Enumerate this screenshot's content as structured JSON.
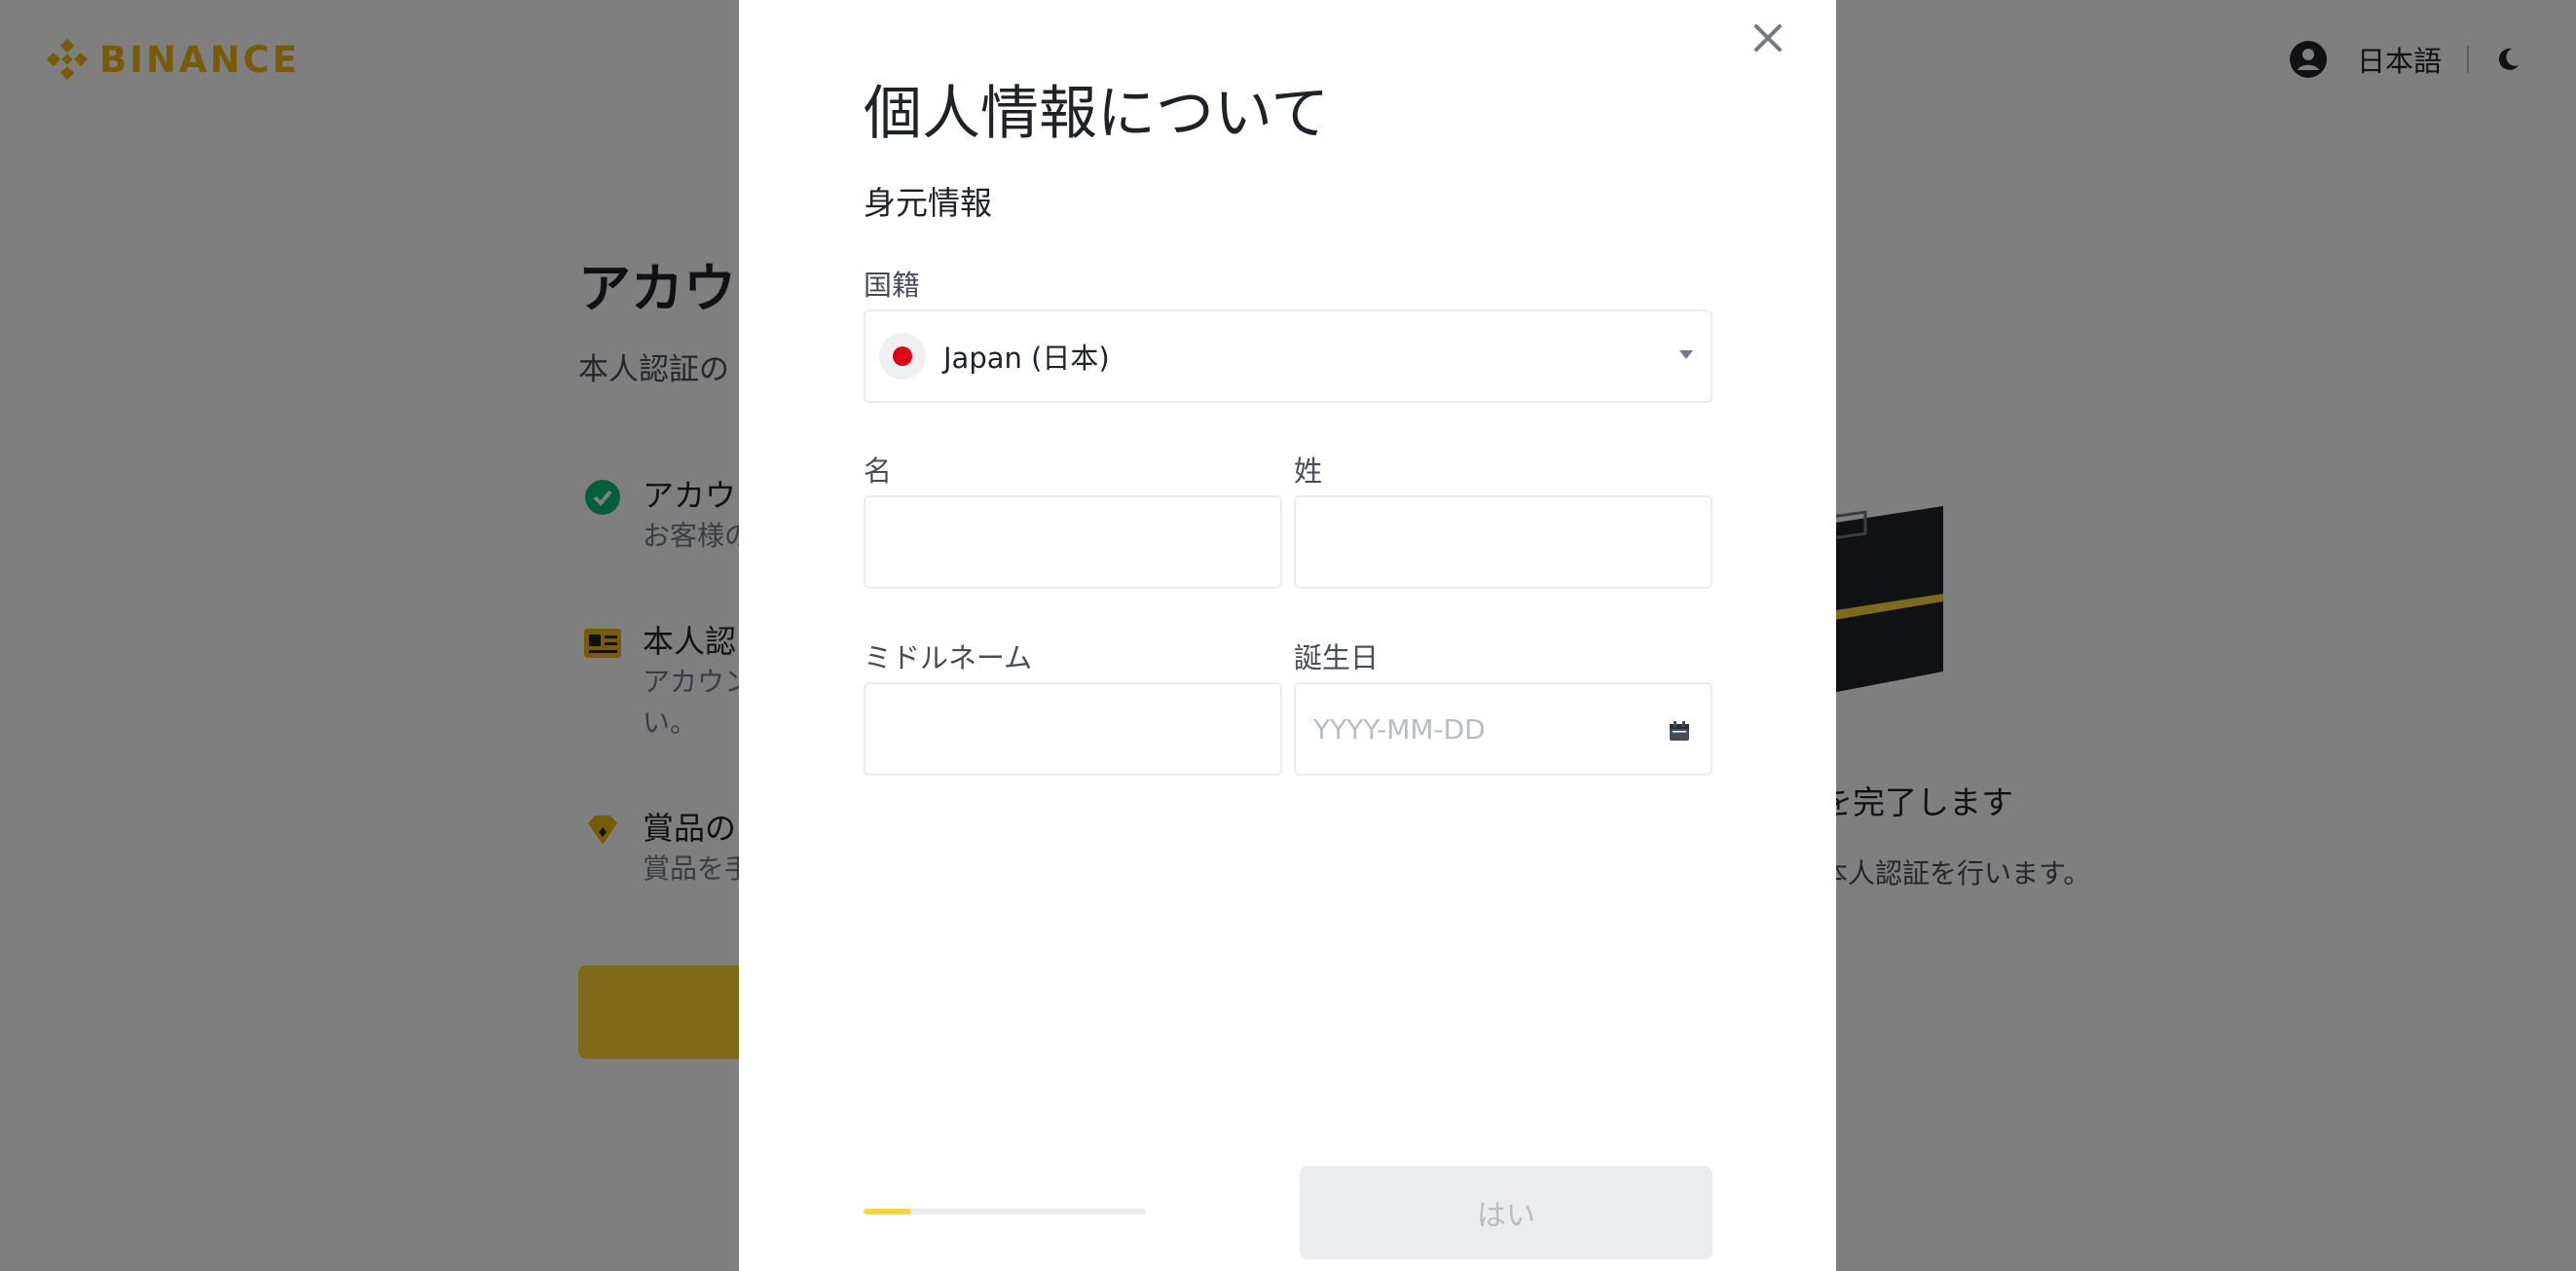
{
  "colors": {
    "brand": "#f0b90b",
    "accent": "#fcd535",
    "disabled_bg": "#eaecef",
    "disabled_text": "#b7bdc6",
    "flag_red": "#e60012"
  },
  "header": {
    "logo_text": "BINANCE",
    "language": "日本語",
    "icons": [
      "binance-logo-icon",
      "user-account-icon",
      "moon-icon"
    ]
  },
  "background": {
    "title": "アカウン",
    "subtitle": "本人認証の",
    "features": [
      {
        "icon": "check-circle-icon",
        "title": "アカウ",
        "desc": "お客様の"
      },
      {
        "icon": "id-card-icon",
        "title": "本人認",
        "desc": "アカウン",
        "desc2": "い。"
      },
      {
        "icon": "diamond-icon",
        "title": "賞品の",
        "desc": "賞品を手"
      }
    ],
    "right_title": "を完了します",
    "right_desc": "本人認証を行います。"
  },
  "modal": {
    "title": "個人情報について",
    "section": "身元情報",
    "nationality": {
      "label": "国籍",
      "value": "Japan (日本)"
    },
    "first_name": {
      "label": "名",
      "value": ""
    },
    "last_name": {
      "label": "姓",
      "value": ""
    },
    "middle_name": {
      "label": "ミドルネーム",
      "value": ""
    },
    "birthday": {
      "label": "誕生日",
      "value": "",
      "placeholder": "YYYY-MM-DD"
    },
    "progress": 0.17,
    "submit_label": "はい"
  }
}
